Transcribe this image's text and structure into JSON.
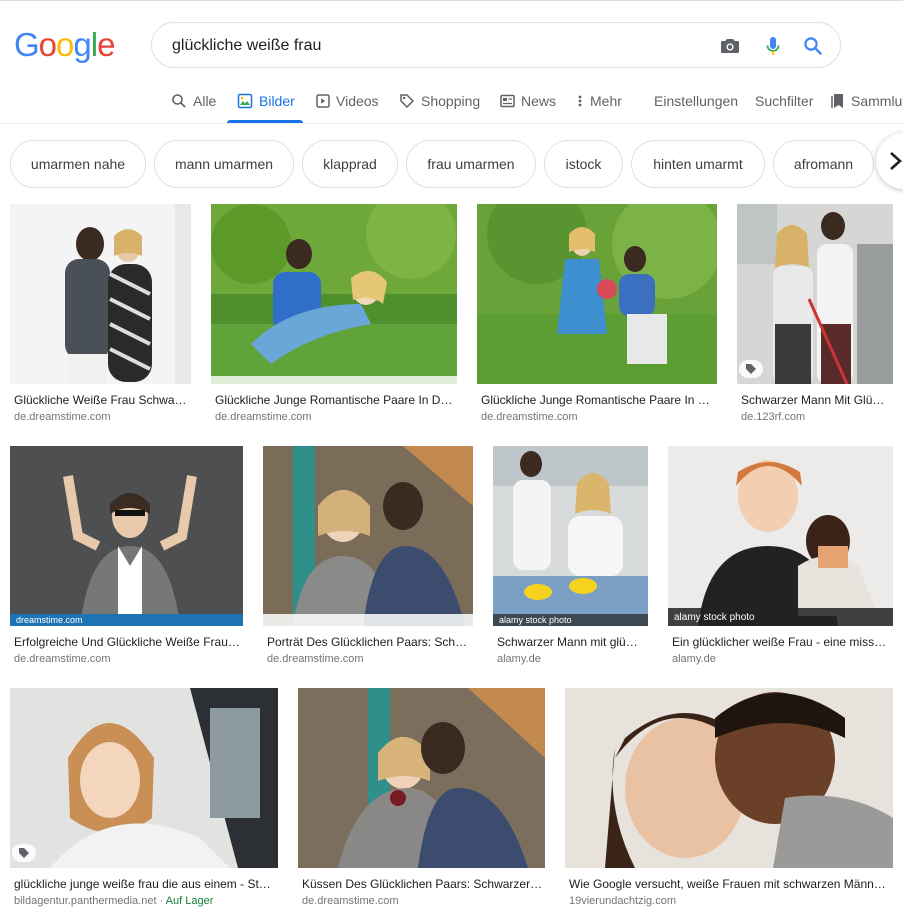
{
  "search": {
    "query": "glückliche weiße frau",
    "camera_icon": "camera-icon",
    "mic_icon": "microphone-icon",
    "search_icon": "search-icon"
  },
  "logo": {
    "letters": [
      "G",
      "o",
      "o",
      "g",
      "l",
      "e"
    ],
    "colors": [
      "#4285f4",
      "#ea4335",
      "#fbbc05",
      "#4285f4",
      "#34a853",
      "#ea4335"
    ]
  },
  "tabs": {
    "all": "Alle",
    "images": "Bilder",
    "videos": "Videos",
    "shopping": "Shopping",
    "news": "News",
    "more": "Mehr",
    "settings": "Einstellungen",
    "tools": "Suchfilter",
    "collections": "Sammlungen"
  },
  "chips": [
    "umarmen nahe",
    "mann umarmen",
    "klapprad",
    "frau umarmen",
    "istock",
    "hinten umarmt",
    "afromann"
  ],
  "results": [
    {
      "title": "Glückliche Weiße Frau Schwa…",
      "source": "de.dreamstime.com"
    },
    {
      "title": "Glückliche Junge Romantische Paare In D…",
      "source": "de.dreamstime.com"
    },
    {
      "title": "Glückliche Junge Romantische Paare In …",
      "source": "de.dreamstime.com"
    },
    {
      "title": "Schwarzer Mann Mit Glü…",
      "source": "de.123rf.com"
    },
    {
      "title": "Erfolgreiche Und Glückliche Weiße Frau…",
      "source": "de.dreamstime.com"
    },
    {
      "title": "Porträt Des Glücklichen Paars: Sch…",
      "source": "de.dreamstime.com"
    },
    {
      "title": "Schwarzer Mann mit glü…",
      "source": "alamy.de"
    },
    {
      "title": "Ein glücklicher weiße Frau - eine miss…",
      "source": "alamy.de"
    },
    {
      "title": "glückliche junge weiße frau die aus einem - St…",
      "source": "bildagentur.panthermedia.net",
      "stock": "Auf Lager"
    },
    {
      "title": "Küssen Des Glücklichen Paars: Schwarzer…",
      "source": "de.dreamstime.com"
    },
    {
      "title": "Wie Google versucht, weiße Frauen mit schwarzen Männ…",
      "source": "19vierundachtzig.com"
    }
  ],
  "watermarks": {
    "dreamstime": "dreamstime.com",
    "alamy": "alamy stock photo"
  },
  "colors": {
    "accent": "#1a73e8",
    "text": "#202124",
    "secondary": "#70757a",
    "stock": "#188038"
  }
}
